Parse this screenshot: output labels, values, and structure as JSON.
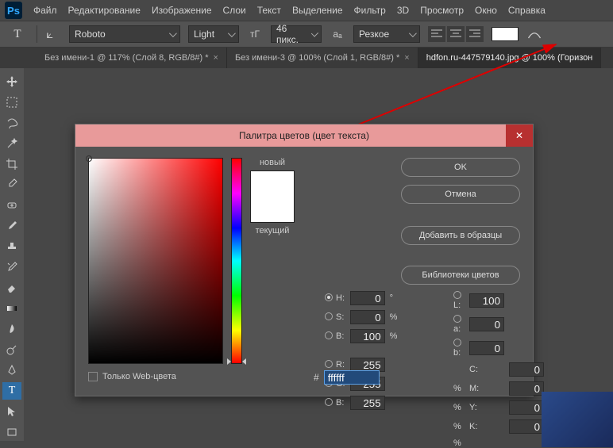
{
  "menu": {
    "items": [
      "Файл",
      "Редактирование",
      "Изображение",
      "Слои",
      "Текст",
      "Выделение",
      "Фильтр",
      "3D",
      "Просмотр",
      "Окно",
      "Справка"
    ]
  },
  "options": {
    "font_family": "Roboto",
    "font_weight": "Light",
    "font_size": "46 пикс.",
    "aa": "Резкое"
  },
  "tabs": [
    {
      "label": "Без имени-1 @ 117% (Слой 8, RGB/8#) *"
    },
    {
      "label": "Без имени-3 @ 100% (Слой 1, RGB/8#) *"
    },
    {
      "label": "hdfon.ru-447579140.jpg @ 100% (Горизон"
    }
  ],
  "dialog": {
    "title": "Палитра цветов (цвет текста)",
    "new_label": "новый",
    "current_label": "текущий",
    "ok": "OK",
    "cancel": "Отмена",
    "add": "Добавить в образцы",
    "libs": "Библиотеки цветов",
    "webonly": "Только Web-цвета",
    "hex": "ffffff",
    "H": "0",
    "S": "0",
    "B": "100",
    "R": "255",
    "G": "255",
    "Bb": "255",
    "L": "100",
    "a": "0",
    "b": "0",
    "C": "0",
    "M": "0",
    "Y": "0",
    "K": "0",
    "deg": "°",
    "pct": "%"
  }
}
